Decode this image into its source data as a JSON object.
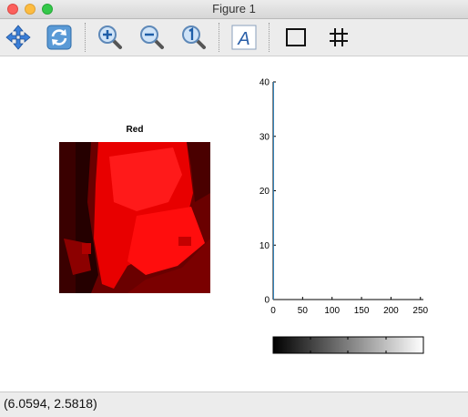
{
  "window": {
    "title": "Figure 1"
  },
  "toolbar": {
    "buttons": [
      {
        "icon": "pan-icon",
        "label": "Pan"
      },
      {
        "icon": "refresh-icon",
        "label": "Reset"
      },
      {
        "icon": "zoom-in-icon",
        "label": "Zoom in"
      },
      {
        "icon": "zoom-out-icon",
        "label": "Zoom out"
      },
      {
        "icon": "zoom-actual-icon",
        "label": "Zoom 1"
      },
      {
        "icon": "text-icon",
        "label": "A"
      },
      {
        "icon": "box-icon",
        "label": "Box"
      },
      {
        "icon": "grid-icon",
        "label": "Grid"
      }
    ]
  },
  "image_panel": {
    "title": "Red"
  },
  "colorbar": {
    "colormap": "gray",
    "range": [
      0,
      255
    ]
  },
  "status": {
    "coords": "(6.0594, 2.5818)"
  },
  "colors": {
    "histogram": "#1f77b4",
    "image_red": "#ff0000"
  },
  "chart_data": {
    "type": "bar",
    "title": "",
    "xlabel": "",
    "ylabel": "",
    "xlim": [
      0,
      255
    ],
    "ylim": [
      0,
      40
    ],
    "x_ticks": [
      0,
      50,
      100,
      150,
      200,
      250
    ],
    "y_ticks": [
      0,
      10,
      20,
      30,
      40
    ],
    "series": [
      {
        "values": [
          40,
          0,
          0,
          0,
          0,
          0,
          0,
          0,
          0,
          0,
          0,
          0,
          0,
          0,
          0,
          0,
          0,
          0,
          0,
          0,
          0,
          0,
          0,
          0,
          0,
          0,
          0,
          0,
          0,
          0,
          0,
          0,
          0,
          0,
          0,
          0,
          0,
          0,
          0,
          0,
          0,
          0,
          0,
          0,
          0,
          0,
          0,
          0,
          0,
          0,
          0,
          0,
          0,
          0,
          0,
          0,
          0,
          0,
          0,
          0,
          0,
          0,
          0,
          0,
          0,
          0,
          0,
          0,
          0,
          0,
          0,
          0,
          0,
          0,
          0,
          0,
          0,
          0,
          0,
          0,
          0,
          0,
          0,
          0,
          0,
          0,
          0,
          0,
          0,
          0,
          0,
          0,
          0,
          0,
          0,
          0,
          0,
          0,
          0,
          0,
          0,
          0,
          0,
          0,
          0,
          0,
          0,
          0,
          0,
          0,
          0,
          0,
          0,
          0,
          0,
          0,
          0,
          0,
          0,
          0,
          0,
          0,
          0,
          0,
          0,
          0,
          0,
          0,
          0,
          0,
          0,
          0,
          0,
          0,
          0,
          0,
          0,
          0,
          0,
          0,
          0,
          0,
          0,
          0,
          0,
          0,
          0,
          0,
          0,
          0,
          0,
          0,
          0,
          0,
          0,
          0,
          0,
          0,
          0,
          0,
          0,
          0,
          0,
          0,
          0,
          0,
          0,
          0,
          0,
          0,
          0,
          0,
          0,
          0,
          0,
          0,
          0,
          0,
          0,
          0,
          0,
          0,
          0,
          0,
          0,
          0,
          0,
          0,
          0,
          0,
          0,
          0,
          0,
          0,
          0,
          0,
          0,
          0,
          0,
          0,
          0,
          0,
          0,
          0,
          0,
          0,
          0,
          0,
          0,
          0,
          0,
          0,
          0,
          0,
          0,
          0,
          0,
          0,
          0,
          0,
          0,
          0,
          0,
          0,
          0,
          0,
          0,
          0,
          0,
          0,
          0,
          0,
          0,
          0,
          0,
          0,
          0,
          0,
          0,
          0,
          0,
          0,
          0,
          0,
          0,
          0,
          0,
          0,
          0,
          0,
          0,
          0,
          0,
          0,
          0,
          0,
          0
        ]
      }
    ]
  }
}
